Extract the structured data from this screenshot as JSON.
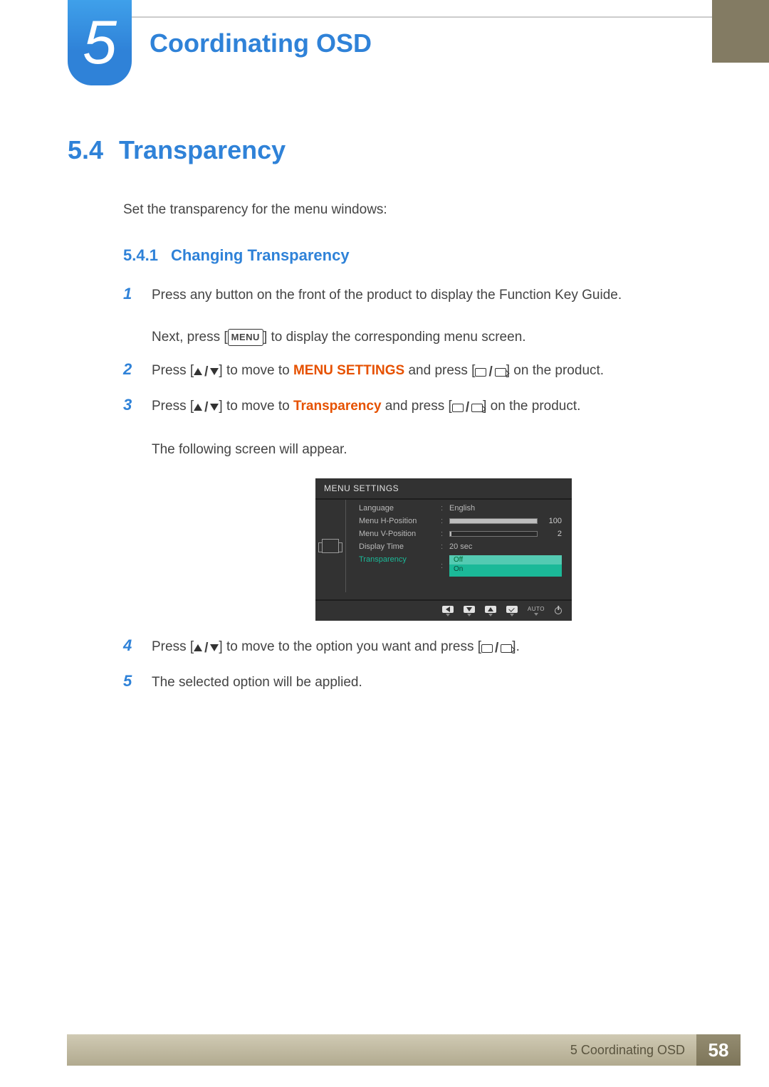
{
  "chapter": {
    "number": "5",
    "title": "Coordinating OSD"
  },
  "section": {
    "number": "5.4",
    "title": "Transparency"
  },
  "intro": "Set the transparency for the menu windows:",
  "subsection": {
    "number": "5.4.1",
    "title": "Changing Transparency"
  },
  "steps": {
    "s1": {
      "num": "1",
      "line1a": "Press any button on the front of the product to display the Function Key Guide.",
      "line2a": "Next, press [",
      "menu_label": "MENU",
      "line2b": "] to display the corresponding menu screen."
    },
    "s2": {
      "num": "2",
      "a": "Press [",
      "b": "] to move to ",
      "kw": "MENU SETTINGS",
      "c": " and press [",
      "d": "] on the product."
    },
    "s3": {
      "num": "3",
      "a": "Press [",
      "b": "] to move to ",
      "kw": "Transparency",
      "c": " and press [",
      "d": "] on the product.",
      "line2": "The following screen will appear."
    },
    "s4": {
      "num": "4",
      "a": "Press [",
      "b": "] to move to the option you want and press [",
      "c": "]."
    },
    "s5": {
      "num": "5",
      "text": "The selected option will be applied."
    }
  },
  "osd": {
    "title": "MENU SETTINGS",
    "rows": {
      "language": {
        "label": "Language",
        "value": "English"
      },
      "menu_h": {
        "label": "Menu H-Position",
        "value": "100",
        "fill_pct": 100
      },
      "menu_v": {
        "label": "Menu V-Position",
        "value": "2",
        "fill_pct": 2
      },
      "display_time": {
        "label": "Display Time",
        "value": "20 sec"
      },
      "transparency": {
        "label": "Transparency",
        "opt_off": "Off",
        "opt_on": "On"
      }
    },
    "nav": {
      "auto": "AUTO"
    }
  },
  "footer": {
    "text": "5 Coordinating OSD",
    "page": "58"
  }
}
